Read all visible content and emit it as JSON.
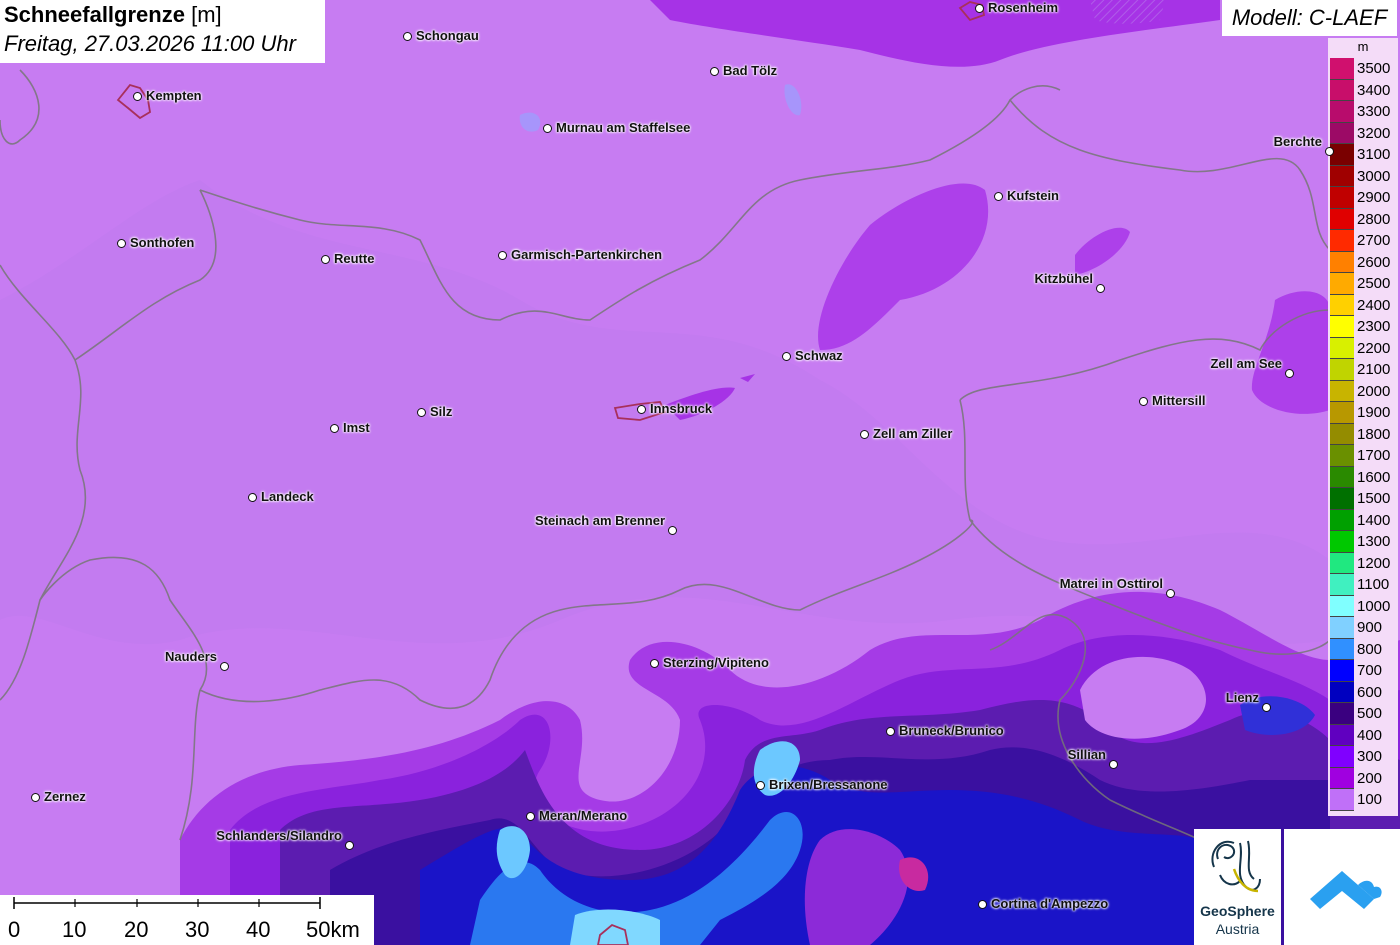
{
  "title": {
    "name": "Schneefallgrenze",
    "unit": "[m]",
    "datetime": "Freitag, 27.03.2026 11:00 Uhr"
  },
  "model": "Modell: C-LAEF",
  "legend": {
    "unit": "m",
    "entries": [
      {
        "label": "3500",
        "color": "#d0106e"
      },
      {
        "label": "3400",
        "color": "#c80e6a"
      },
      {
        "label": "3300",
        "color": "#b80c6c"
      },
      {
        "label": "3200",
        "color": "#9c0a66"
      },
      {
        "label": "3100",
        "color": "#7a0000"
      },
      {
        "label": "3000",
        "color": "#a00000"
      },
      {
        "label": "2900",
        "color": "#c00000"
      },
      {
        "label": "2800",
        "color": "#e00000"
      },
      {
        "label": "2700",
        "color": "#ff2a00"
      },
      {
        "label": "2600",
        "color": "#ff8000"
      },
      {
        "label": "2500",
        "color": "#ffaa00"
      },
      {
        "label": "2400",
        "color": "#ffd000"
      },
      {
        "label": "2300",
        "color": "#ffff00"
      },
      {
        "label": "2200",
        "color": "#d8f000"
      },
      {
        "label": "2100",
        "color": "#c0d400"
      },
      {
        "label": "2000",
        "color": "#c8b400"
      },
      {
        "label": "1900",
        "color": "#b89800"
      },
      {
        "label": "1800",
        "color": "#948c00"
      },
      {
        "label": "1700",
        "color": "#6a9000"
      },
      {
        "label": "1600",
        "color": "#2a8a00"
      },
      {
        "label": "1500",
        "color": "#007000"
      },
      {
        "label": "1400",
        "color": "#00a000"
      },
      {
        "label": "1300",
        "color": "#00c800"
      },
      {
        "label": "1200",
        "color": "#20e880"
      },
      {
        "label": "1100",
        "color": "#40f0c0"
      },
      {
        "label": "1000",
        "color": "#80ffff"
      },
      {
        "label": "900",
        "color": "#80d0ff"
      },
      {
        "label": "800",
        "color": "#3090ff"
      },
      {
        "label": "700",
        "color": "#0000ff"
      },
      {
        "label": "600",
        "color": "#0000c0"
      },
      {
        "label": "500",
        "color": "#3a0080"
      },
      {
        "label": "400",
        "color": "#6000c0"
      },
      {
        "label": "300",
        "color": "#8000ff"
      },
      {
        "label": "200",
        "color": "#a000e0"
      },
      {
        "label": "100",
        "color": "#c070f8"
      }
    ]
  },
  "cities": [
    {
      "name": "Schongau"
    },
    {
      "name": "Rosenheim"
    },
    {
      "name": "Kempten"
    },
    {
      "name": "Bad Tölz"
    },
    {
      "name": "Murnau am Staffelsee"
    },
    {
      "name": "Berchte"
    },
    {
      "name": "Kufstein"
    },
    {
      "name": "Sonthofen"
    },
    {
      "name": "Reutte"
    },
    {
      "name": "Garmisch-Partenkirchen"
    },
    {
      "name": "Kitzbühel"
    },
    {
      "name": "Schwaz"
    },
    {
      "name": "Zell am See"
    },
    {
      "name": "Innsbruck"
    },
    {
      "name": "Mittersill"
    },
    {
      "name": "Silz"
    },
    {
      "name": "Imst"
    },
    {
      "name": "Zell am Ziller"
    },
    {
      "name": "Landeck"
    },
    {
      "name": "Steinach am Brenner"
    },
    {
      "name": "Matrei in Osttirol"
    },
    {
      "name": "Nauders"
    },
    {
      "name": "Sterzing/Vipiteno"
    },
    {
      "name": "Lienz"
    },
    {
      "name": "Bruneck/Brunico"
    },
    {
      "name": "Sillian"
    },
    {
      "name": "Brixen/Bressanone"
    },
    {
      "name": "Zernez"
    },
    {
      "name": "Meran/Merano"
    },
    {
      "name": "Schlanders/Silandro"
    },
    {
      "name": "Cortina d'Ampezzo"
    }
  ],
  "scale": {
    "labels": [
      "0",
      "10",
      "20",
      "30",
      "40",
      "50km"
    ]
  },
  "logos": {
    "geosphere_line1": "GeoSphere",
    "geosphere_line2": "Austria"
  }
}
